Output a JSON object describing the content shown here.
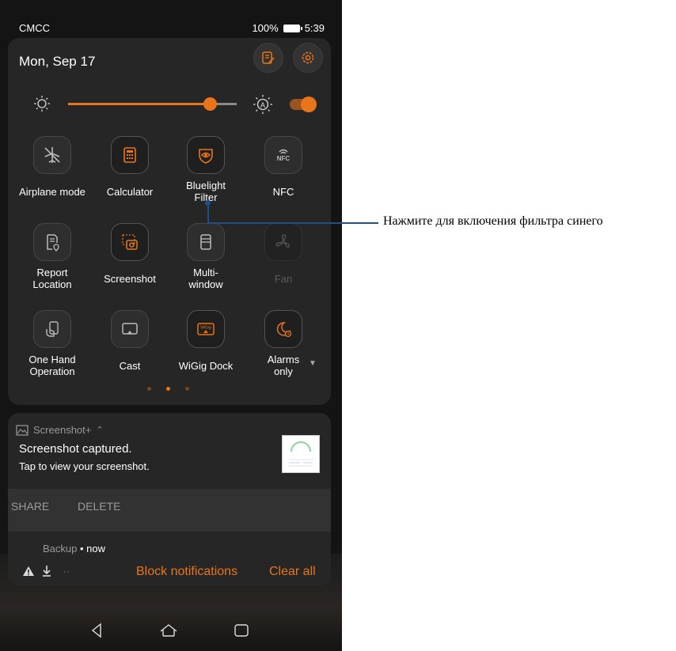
{
  "status_bar": {
    "carrier": "CMCC",
    "battery": "100%",
    "time": "5:39"
  },
  "header": {
    "date": "Mon, Sep 17",
    "edit_icon": "edit-list-icon",
    "settings_icon": "gear-icon"
  },
  "brightness": {
    "level": 0.84,
    "auto_brightness_on": true
  },
  "tiles": [
    {
      "label": "Airplane mode",
      "icon": "airplane-icon",
      "active": false
    },
    {
      "label": "Calculator",
      "icon": "calculator-icon",
      "active": true
    },
    {
      "label": "Bluelight Filter",
      "icon": "eye-shield-icon",
      "active": true
    },
    {
      "label": "NFC",
      "icon": "nfc-icon",
      "active": false
    },
    {
      "label": "Report Location",
      "icon": "report-location-icon",
      "active": false
    },
    {
      "label": "Screenshot",
      "icon": "screenshot-icon",
      "active": true
    },
    {
      "label": "Multi-window",
      "icon": "multi-window-icon",
      "active": false
    },
    {
      "label": "Fan",
      "icon": "fan-icon",
      "active": false,
      "disabled": true
    },
    {
      "label": "One Hand Operation",
      "icon": "one-hand-icon",
      "active": false
    },
    {
      "label": "Cast",
      "icon": "cast-icon",
      "active": false
    },
    {
      "label": "WiGig Dock",
      "icon": "wigig-icon",
      "active": true
    },
    {
      "label": "Alarms only",
      "icon": "alarm-moon-icon",
      "active": true
    }
  ],
  "page_indicator": {
    "pages": 3,
    "current": 2
  },
  "notification": {
    "app": "Screenshot+",
    "title": "Screenshot captured.",
    "text": "Tap to view your screenshot.",
    "actions": [
      "SHARE",
      "DELETE"
    ]
  },
  "notification_group": {
    "app": "Backup",
    "time": "now",
    "block_label": "Block notifications",
    "clear_label": "Clear all"
  },
  "callout": {
    "text": "Нажмите для включения фильтра синего"
  },
  "colors": {
    "accent": "#e8751a",
    "panel": "#262626",
    "callout_line": "#1f4f8a"
  }
}
